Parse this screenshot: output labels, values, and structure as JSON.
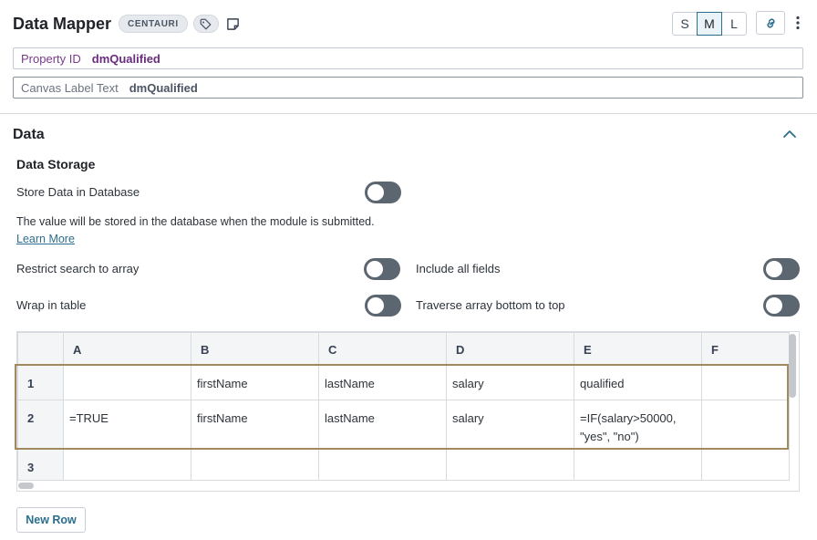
{
  "header": {
    "title": "Data Mapper",
    "badge": "CENTAURI",
    "sizes": [
      "S",
      "M",
      "L"
    ],
    "active_size": "M"
  },
  "fields": {
    "property_label": "Property ID",
    "property_value": "dmQualified",
    "canvas_label": "Canvas Label Text",
    "canvas_value": "dmQualified"
  },
  "section": {
    "title": "Data",
    "subtitle": "Data Storage"
  },
  "settings": {
    "store_db_label": "Store Data in Database",
    "store_db_on": false,
    "helper_text": "The value will be stored in the database when the module is submitted.",
    "learn_more": "Learn More",
    "restrict_label": "Restrict search to array",
    "restrict_on": false,
    "include_label": "Include all fields",
    "include_on": false,
    "wrap_label": "Wrap in table",
    "wrap_on": false,
    "traverse_label": "Traverse array bottom to top",
    "traverse_on": false
  },
  "grid": {
    "columns": [
      "A",
      "B",
      "C",
      "D",
      "E",
      "F"
    ],
    "rows": [
      {
        "num": "1",
        "cells": [
          "",
          "firstName",
          "lastName",
          "salary",
          "qualified",
          ""
        ]
      },
      {
        "num": "2",
        "cells": [
          "=TRUE",
          "firstName",
          "lastName",
          "salary",
          "=IF(salary>50000, \"yes\", \"no\")",
          ""
        ]
      },
      {
        "num": "3",
        "cells": [
          "",
          "",
          "",
          "",
          "",
          ""
        ]
      }
    ]
  },
  "actions": {
    "new_row": "New Row"
  },
  "colors": {
    "accent": "#2c6e8e",
    "toggle_off": "#5c6670",
    "selection_border": "#a08a5e",
    "property_text": "#6a2c7e"
  }
}
